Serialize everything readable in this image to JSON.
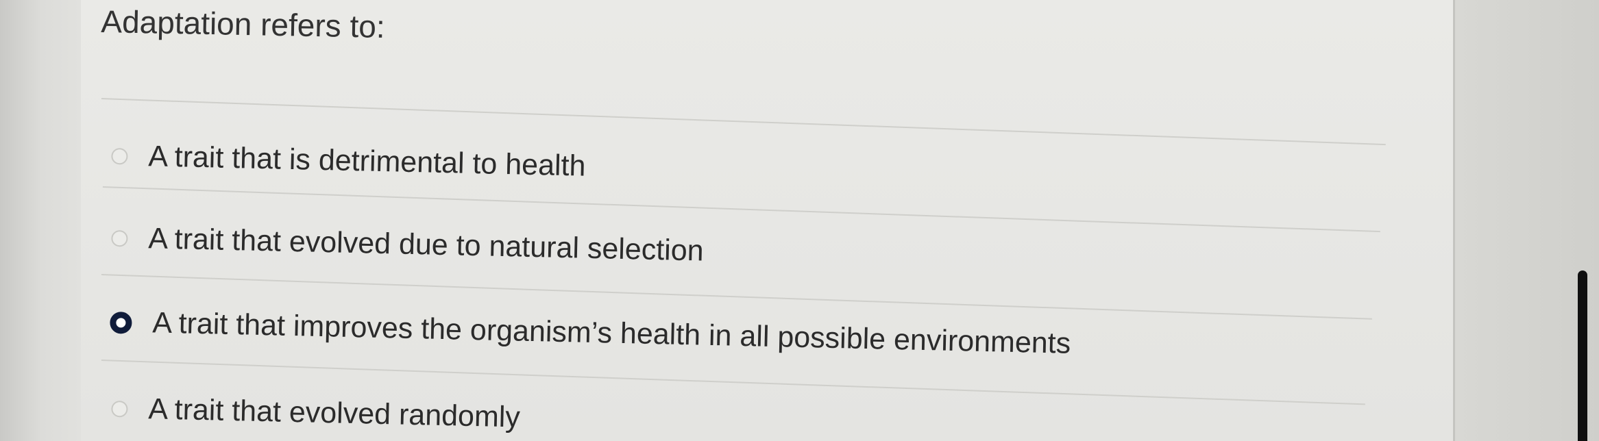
{
  "question": {
    "text": "Adaptation refers to:"
  },
  "options": [
    {
      "label": "A trait that is detrimental to health",
      "selected": false
    },
    {
      "label": "A trait that evolved due to natural selection",
      "selected": false
    },
    {
      "label": "A trait that improves the organism’s health in all possible environments",
      "selected": true
    },
    {
      "label": "A trait that evolved randomly",
      "selected": false
    }
  ],
  "colors": {
    "selected_radio": "#101c3a",
    "text": "#2b2b2b",
    "background": "#e6e6e3"
  }
}
